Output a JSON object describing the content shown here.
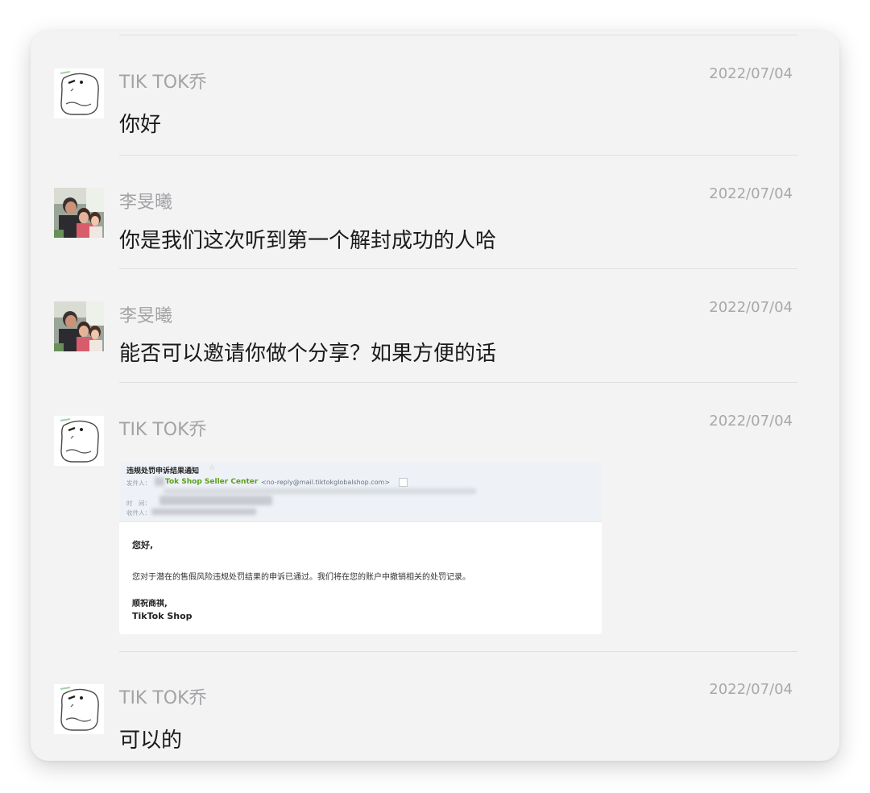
{
  "messages": [
    {
      "sender": "TIK TOK乔",
      "date": "2022/07/04",
      "text": "你好",
      "avatar": "polar-bear-icon"
    },
    {
      "sender": "李旻曦",
      "date": "2022/07/04",
      "text": "你是我们这次听到第一个解封成功的人哈",
      "avatar": "family-photo"
    },
    {
      "sender": "李旻曦",
      "date": "2022/07/04",
      "text": "能否可以邀请你做个分享？如果方便的话",
      "avatar": "family-photo"
    },
    {
      "sender": "TIK TOK乔",
      "date": "2022/07/04",
      "avatar": "polar-bear-icon",
      "email": {
        "subject": "违规处罚申诉结果通知",
        "from_label": "发件人：",
        "from_name": "Tok Shop Seller Center",
        "from_address": "<no-reply@mail.tiktokglobalshop.com>",
        "time_label": "时　间：",
        "to_label": "收件人：",
        "greeting": "您好,",
        "body": "您对于潜在的售假风险违规处罚结果的申诉已通过。我们将在您的账户中撤销相关的处罚记录。",
        "closing": "顺祝商祺,",
        "signature": "TikTok Shop"
      }
    },
    {
      "sender": "TIK TOK乔",
      "date": "2022/07/04",
      "text": "可以的",
      "avatar": "polar-bear-icon"
    }
  ],
  "colors": {
    "card_bg": "#f3f3f4",
    "sender_gray": "#a3a3a6",
    "message_text": "#1a1a1a",
    "email_sender_green": "#5a9f1e"
  }
}
